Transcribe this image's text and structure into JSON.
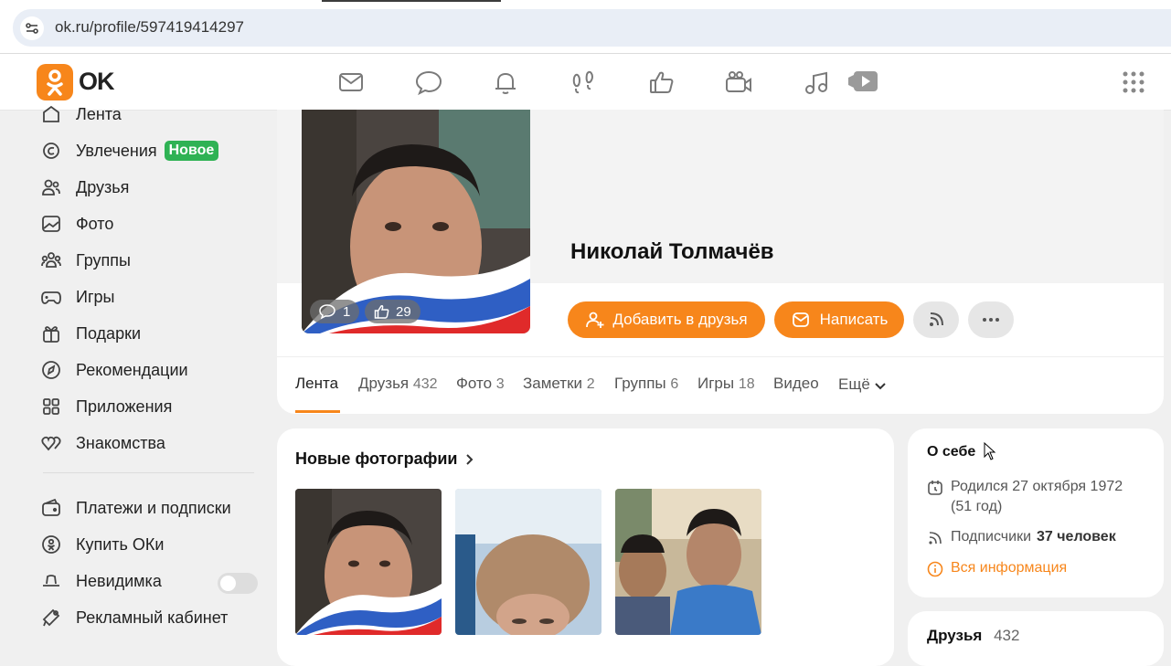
{
  "browser": {
    "url": "ok.ru/profile/597419414297"
  },
  "header": {
    "logo_text": "OK",
    "brand_color": "#f7861b",
    "nav_icons": [
      "mail-icon",
      "chat-icon",
      "bell-icon",
      "footprints-icon",
      "thumbs-up-icon",
      "video-camera-icon",
      "music-icon",
      "video-play-icon",
      "apps-grid-icon"
    ]
  },
  "sidebar": {
    "items": [
      {
        "label": "Лента",
        "icon": "home-icon"
      },
      {
        "label": "Увлечения",
        "icon": "hobby-icon",
        "badge": "Новое"
      },
      {
        "label": "Друзья",
        "icon": "friends-icon"
      },
      {
        "label": "Фото",
        "icon": "photo-icon"
      },
      {
        "label": "Группы",
        "icon": "groups-icon"
      },
      {
        "label": "Игры",
        "icon": "gamepad-icon"
      },
      {
        "label": "Подарки",
        "icon": "gift-icon"
      },
      {
        "label": "Рекомендации",
        "icon": "compass-icon"
      },
      {
        "label": "Приложения",
        "icon": "apps-icon"
      },
      {
        "label": "Знакомства",
        "icon": "hearts-icon"
      }
    ],
    "extra": [
      {
        "label": "Платежи и подписки",
        "icon": "wallet-icon"
      },
      {
        "label": "Купить ОКи",
        "icon": "coin-icon"
      },
      {
        "label": "Невидимка",
        "icon": "invisible-icon",
        "toggle": false
      },
      {
        "label": "Рекламный кабинет",
        "icon": "megaphone-icon"
      }
    ]
  },
  "profile": {
    "name": "Николай Толмачёв",
    "comments_count": "1",
    "likes_count": "29",
    "add_friend_label": "Добавить в друзья",
    "message_label": "Написать",
    "tabs": [
      {
        "label": "Лента",
        "count": ""
      },
      {
        "label": "Друзья",
        "count": "432"
      },
      {
        "label": "Фото",
        "count": "3"
      },
      {
        "label": "Заметки",
        "count": "2"
      },
      {
        "label": "Группы",
        "count": "6"
      },
      {
        "label": "Игры",
        "count": "18"
      },
      {
        "label": "Видео",
        "count": ""
      },
      {
        "label": "Ещё",
        "count": ""
      }
    ]
  },
  "photos": {
    "title": "Новые фотографии"
  },
  "about": {
    "title": "О себе",
    "born_line1": "Родился 27 октября 1972",
    "born_line2": "(51 год)",
    "subscribers_label": "Подписчики",
    "subscribers_value": "37 человек",
    "all_info_label": "Вся информация"
  },
  "friends_card": {
    "title": "Друзья",
    "count": "432"
  }
}
